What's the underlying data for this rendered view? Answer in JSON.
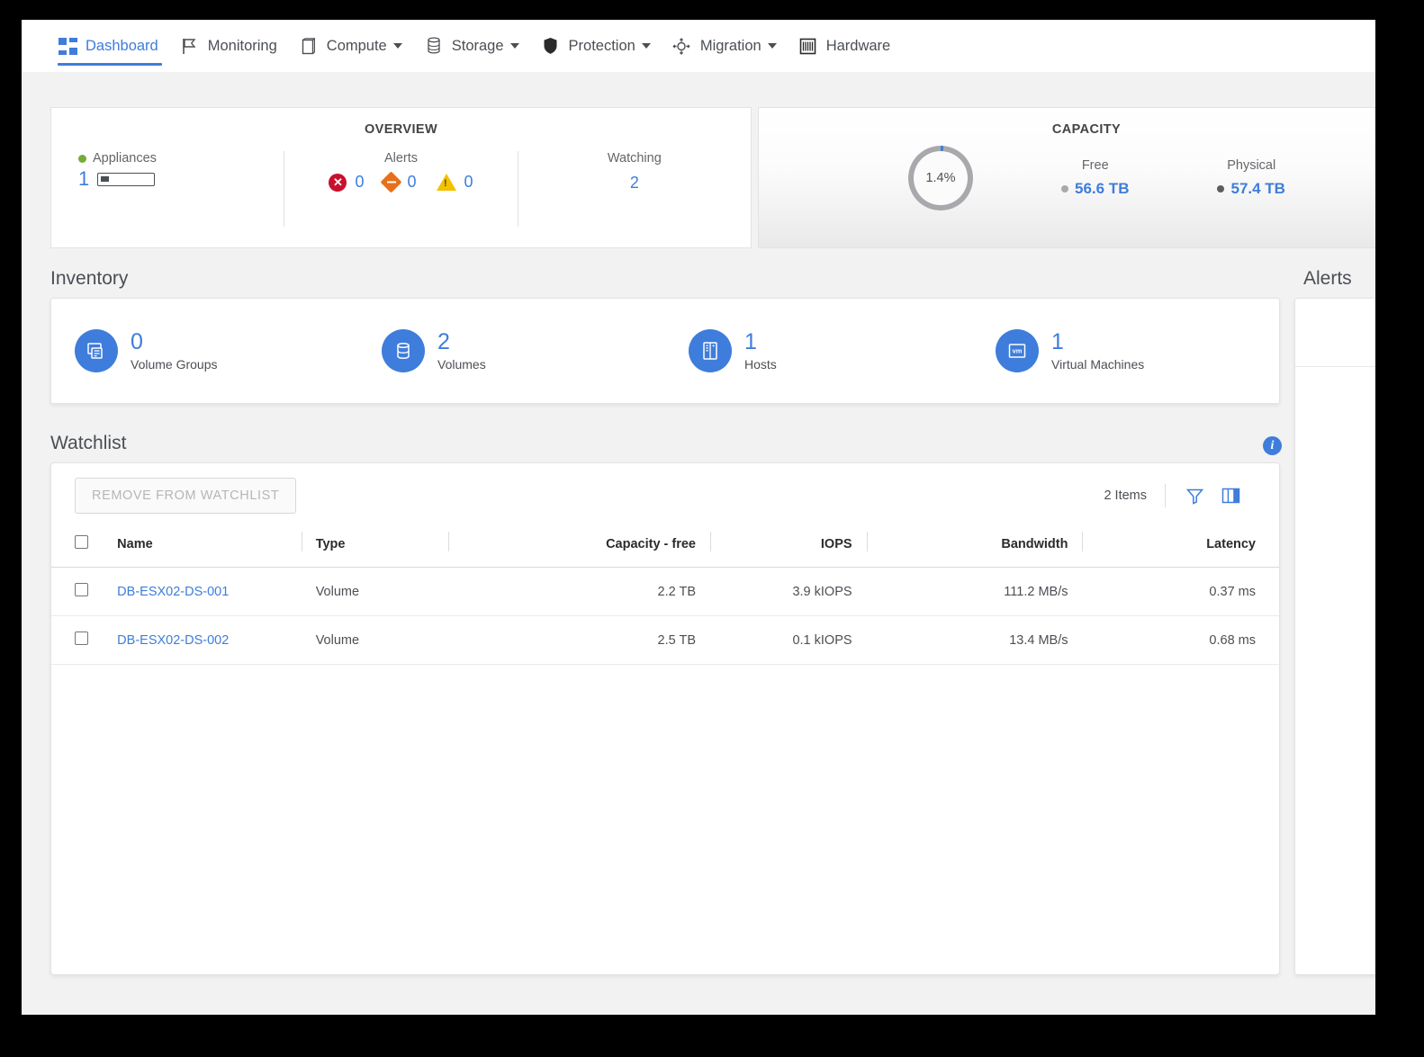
{
  "nav": {
    "items": [
      {
        "label": "Dashboard",
        "icon": "dashboard-grid-icon",
        "active": true,
        "caret": false
      },
      {
        "label": "Monitoring",
        "icon": "flag-icon",
        "active": false,
        "caret": false
      },
      {
        "label": "Compute",
        "icon": "server-icon",
        "active": false,
        "caret": true
      },
      {
        "label": "Storage",
        "icon": "database-icon",
        "active": false,
        "caret": true
      },
      {
        "label": "Protection",
        "icon": "shield-icon",
        "active": false,
        "caret": true
      },
      {
        "label": "Migration",
        "icon": "migration-icon",
        "active": false,
        "caret": true
      },
      {
        "label": "Hardware",
        "icon": "rack-icon",
        "active": false,
        "caret": false
      }
    ]
  },
  "overview": {
    "title": "OVERVIEW",
    "appliances": {
      "label": "Appliances",
      "count": "1",
      "status_color": "#74ac37"
    },
    "alerts": {
      "label": "Alerts",
      "items": [
        {
          "severity": "critical",
          "icon": "critical-circle-icon",
          "count": "0",
          "color": "#c8102e"
        },
        {
          "severity": "major",
          "icon": "major-diamond-icon",
          "count": "0",
          "color": "#e8701a"
        },
        {
          "severity": "minor",
          "icon": "warning-triangle-icon",
          "count": "0",
          "color": "#f2c100"
        }
      ]
    },
    "watching": {
      "label": "Watching",
      "count": "2"
    }
  },
  "capacity": {
    "title": "CAPACITY",
    "used_percent": "1.4%",
    "free": {
      "label": "Free",
      "value": "56.6 TB",
      "dot_color": "#a8a9ad"
    },
    "physical": {
      "label": "Physical",
      "value": "57.4 TB",
      "dot_color": "#5d5d5d"
    }
  },
  "inventory": {
    "title": "Inventory",
    "items": [
      {
        "count": "0",
        "label": "Volume Groups",
        "icon": "volume-group-icon"
      },
      {
        "count": "2",
        "label": "Volumes",
        "icon": "volume-icon"
      },
      {
        "count": "1",
        "label": "Hosts",
        "icon": "host-icon"
      },
      {
        "count": "1",
        "label": "Virtual Machines",
        "icon": "vm-icon"
      }
    ]
  },
  "watchlist": {
    "title": "Watchlist",
    "info_icon": "info-icon",
    "remove_button": "REMOVE FROM WATCHLIST",
    "items_count": "2 Items",
    "filter_icon": "filter-funnel-icon",
    "columns_icon": "column-chooser-icon",
    "columns": [
      "Name",
      "Type",
      "Capacity - free",
      "IOPS",
      "Bandwidth",
      "Latency"
    ],
    "rows": [
      {
        "name": "DB-ESX02-DS-001",
        "type": "Volume",
        "capacity_free": "2.2 TB",
        "iops": "3.9 kIOPS",
        "bandwidth": "111.2 MB/s",
        "latency": "0.37 ms",
        "checked": false
      },
      {
        "name": "DB-ESX02-DS-002",
        "type": "Volume",
        "capacity_free": "2.5 TB",
        "iops": "0.1 kIOPS",
        "bandwidth": "13.4 MB/s",
        "latency": "0.68 ms",
        "checked": false
      }
    ]
  },
  "alerts_panel": {
    "title": "Alerts"
  },
  "colors": {
    "accent": "#3e7ddb",
    "text": "#4b4f54",
    "page_bg": "#f2f2f2"
  }
}
